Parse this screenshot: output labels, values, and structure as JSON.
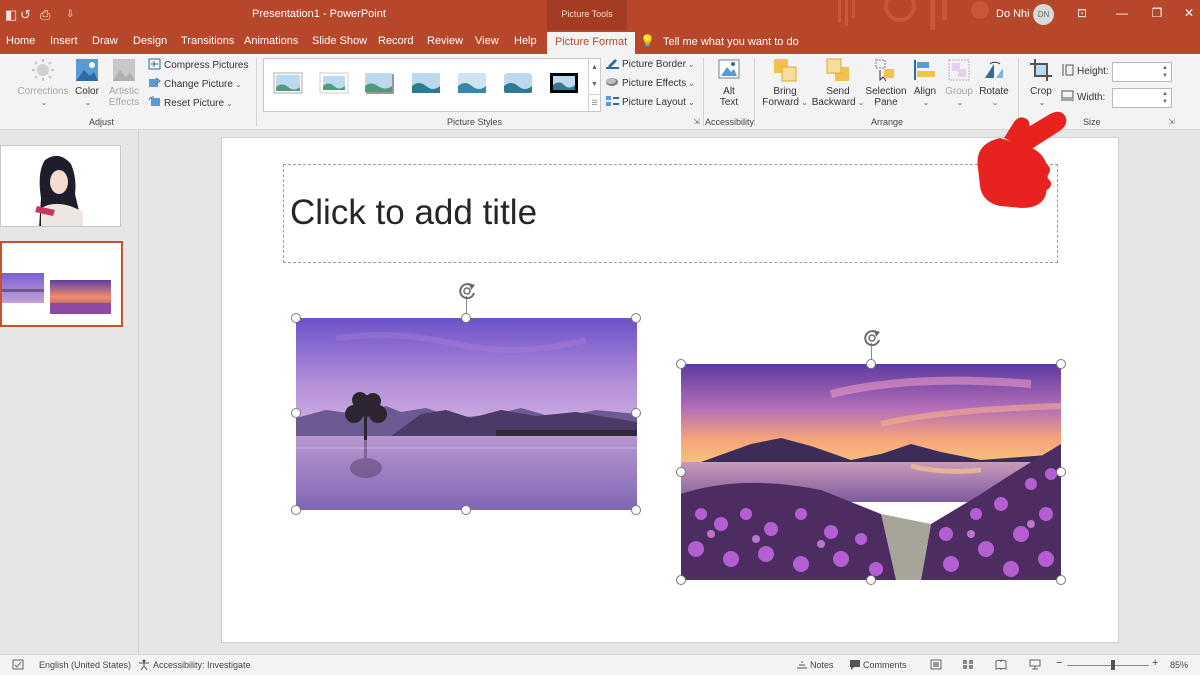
{
  "app": {
    "doc_title": "Presentation1  -  PowerPoint",
    "contextual_tab_group": "Picture Tools",
    "user_name": "Do Nhi",
    "user_initials": "DN"
  },
  "tabs": [
    {
      "label": "Home"
    },
    {
      "label": "Insert"
    },
    {
      "label": "Draw"
    },
    {
      "label": "Design"
    },
    {
      "label": "Transitions"
    },
    {
      "label": "Animations"
    },
    {
      "label": "Slide Show"
    },
    {
      "label": "Record"
    },
    {
      "label": "Review"
    },
    {
      "label": "View"
    },
    {
      "label": "Help"
    },
    {
      "label": "Picture Format",
      "active": true
    }
  ],
  "tell_me": "Tell me what you want to do",
  "ribbon": {
    "adjust": {
      "label": "Adjust",
      "corrections": "Corrections",
      "color": "Color",
      "artistic_line1": "Artistic",
      "artistic_line2": "Effects",
      "compress": "Compress Pictures",
      "change": "Change Picture",
      "reset": "Reset Picture"
    },
    "picture_styles": {
      "label": "Picture Styles",
      "border": "Picture Border",
      "effects": "Picture Effects",
      "layout": "Picture Layout"
    },
    "accessibility": {
      "label": "Accessibility",
      "alt_line1": "Alt",
      "alt_line2": "Text"
    },
    "arrange": {
      "label": "Arrange",
      "bring_line1": "Bring",
      "bring_line2": "Forward",
      "send_line1": "Send",
      "send_line2": "Backward",
      "selection_line1": "Selection",
      "selection_line2": "Pane",
      "align": "Align",
      "group": "Group",
      "rotate": "Rotate"
    },
    "size": {
      "label": "Size",
      "crop": "Crop",
      "height_label": "Height:",
      "width_label": "Width:",
      "height_value": "",
      "width_value": ""
    }
  },
  "slide": {
    "title_placeholder": "Click to add title"
  },
  "statusbar": {
    "language": "English (United States)",
    "accessibility": "Accessibility: Investigate",
    "notes": "Notes",
    "comments": "Comments",
    "zoom": "85%",
    "zoom_fraction": 0.56
  },
  "colors": {
    "accent": "#b7472a",
    "ribbon_bg": "#f3f3f3",
    "annotation_hand": "#e8231f"
  },
  "icons": {
    "hand": "pointing-hand-annotation-icon"
  }
}
